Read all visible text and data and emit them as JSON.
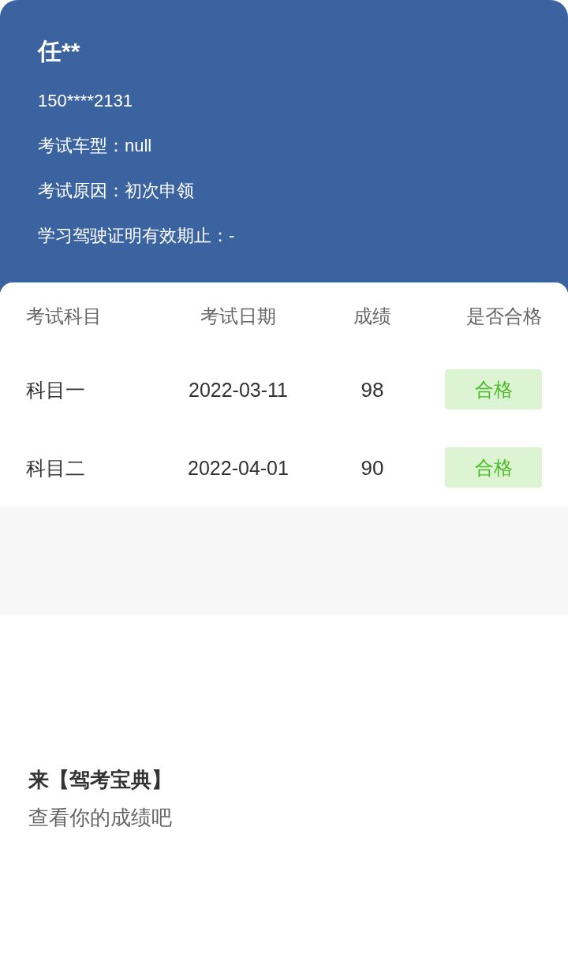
{
  "header": {
    "name": "任**",
    "phone": "150****2131",
    "fields": [
      {
        "label": "考试车型：",
        "value": "null"
      },
      {
        "label": "考试原因：",
        "value": "初次申领"
      },
      {
        "label": "学习驾驶证明有效期止：",
        "value": "-"
      }
    ]
  },
  "table": {
    "columns": [
      "考试科目",
      "考试日期",
      "成绩",
      "是否合格"
    ],
    "rows": [
      {
        "subject": "科目一",
        "date": "2022-03-11",
        "score": "98",
        "result": "合格",
        "passed": true
      },
      {
        "subject": "科目二",
        "date": "2022-04-01",
        "score": "90",
        "result": "合格",
        "passed": true
      }
    ]
  },
  "footer": {
    "title": "来【驾考宝典】",
    "subtitle": "查看你的成绩吧"
  }
}
